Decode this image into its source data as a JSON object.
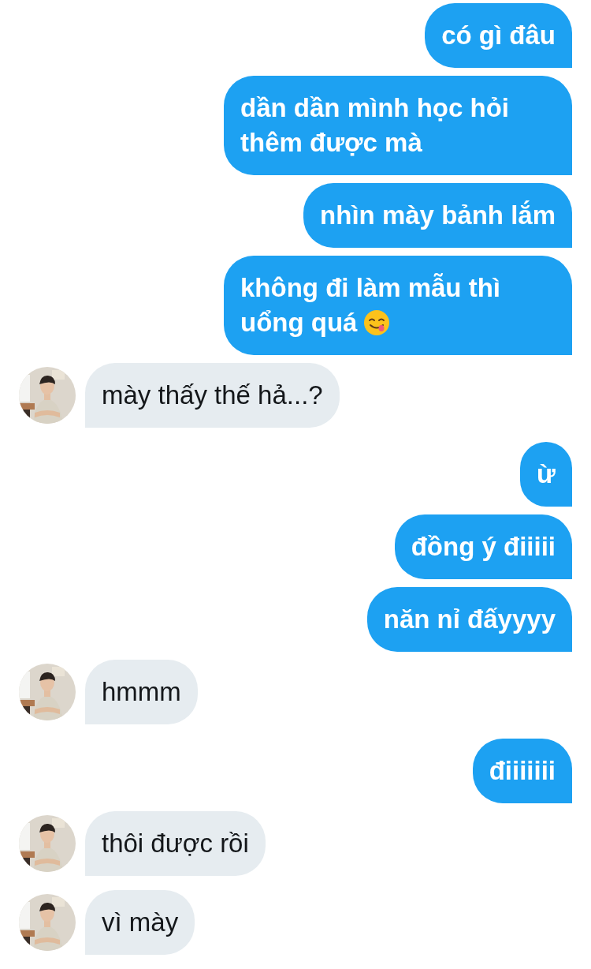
{
  "messages": [
    {
      "kind": "sent",
      "text": "có gì đâu"
    },
    {
      "kind": "sent",
      "text": "dần dần mình học hỏi thêm được mà"
    },
    {
      "kind": "sent",
      "text": "nhìn mày bảnh lắm"
    },
    {
      "kind": "sent",
      "text": "không đi làm mẫu thì uổng quá",
      "emoji": true
    },
    {
      "kind": "received",
      "text": "mày thấy thế hả...?"
    },
    {
      "kind": "sent",
      "text": "ừ"
    },
    {
      "kind": "sent",
      "text": "đồng ý điiiii"
    },
    {
      "kind": "sent",
      "text": "năn nỉ đấyyyy"
    },
    {
      "kind": "received",
      "text": "hmmm"
    },
    {
      "kind": "sent",
      "text": "điiiiiii"
    },
    {
      "kind": "received",
      "text": "thôi được rồi"
    },
    {
      "kind": "received",
      "text": "vì mày"
    }
  ]
}
